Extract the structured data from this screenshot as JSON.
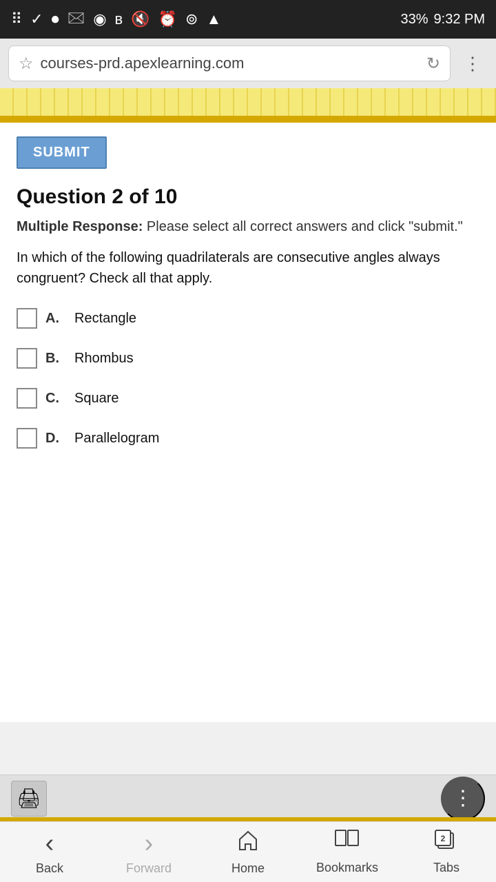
{
  "statusBar": {
    "time": "9:32 PM",
    "battery": "33%"
  },
  "browser": {
    "url": "courses-prd.apexlearning.com",
    "starIcon": "☆",
    "reloadIcon": "↻",
    "menuIcon": "⋮"
  },
  "submit": {
    "label": "SUBMIT"
  },
  "question": {
    "title": "Question 2 of 10",
    "instructionLabel": "Multiple Response:",
    "instructionText": " Please select all correct answers and click \"submit.\"",
    "text": "In which of the following quadrilaterals are consecutive angles always congruent? Check all that apply."
  },
  "answers": [
    {
      "id": "A",
      "label": "A.",
      "text": "Rectangle"
    },
    {
      "id": "B",
      "label": "B.",
      "text": "Rhombus"
    },
    {
      "id": "C",
      "label": "C.",
      "text": "Square"
    },
    {
      "id": "D",
      "label": "D.",
      "text": "Parallelogram"
    }
  ],
  "toolbar": {
    "printIcon": "🖨",
    "moreIcon": "⋮"
  },
  "nav": [
    {
      "id": "back",
      "label": "Back",
      "icon": "‹",
      "disabled": false
    },
    {
      "id": "forward",
      "label": "Forward",
      "icon": "›",
      "disabled": true
    },
    {
      "id": "home",
      "label": "Home",
      "icon": "⌂",
      "disabled": false
    },
    {
      "id": "bookmarks",
      "label": "Bookmarks",
      "icon": "□□",
      "disabled": false
    },
    {
      "id": "tabs",
      "label": "Tabs",
      "icon": "⧉",
      "disabled": false
    }
  ]
}
